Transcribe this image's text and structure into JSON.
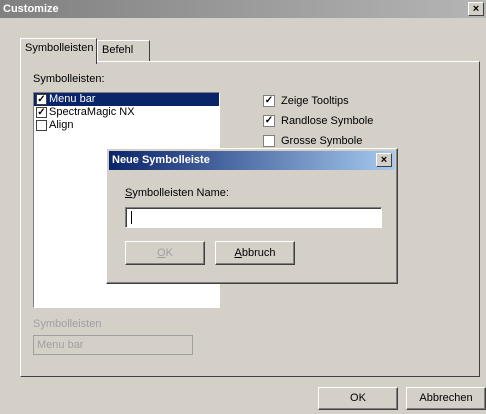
{
  "window": {
    "title": "Customize",
    "close_glyph": "×"
  },
  "tabs": [
    {
      "label": "Symbolleisten",
      "active": true
    },
    {
      "label": "Befehl",
      "active": false
    }
  ],
  "toolbars_panel": {
    "label": "Symbolleisten:",
    "items": [
      {
        "label": "Menu bar",
        "checked": true,
        "selected": true
      },
      {
        "label": "SpectraMagic NX",
        "checked": true,
        "selected": false
      },
      {
        "label": "Align",
        "checked": false,
        "selected": false
      }
    ],
    "name_label": "Symbolleisten",
    "name_value": "Menu bar"
  },
  "options": [
    {
      "label": "Zeige Tooltips",
      "checked": true
    },
    {
      "label": "Randlose Symbole",
      "checked": true
    },
    {
      "label": "Grosse Symbole",
      "checked": false
    }
  ],
  "footer": {
    "ok": "OK",
    "cancel": "Abbrechen"
  },
  "new_toolbar_dialog": {
    "title": "Neue Symbolleiste",
    "close_glyph": "×",
    "name_label_first": "S",
    "name_label_rest": "ymbolleisten Name:",
    "name_value": "",
    "ok_first": "O",
    "ok_rest": "K",
    "cancel_first": "A",
    "cancel_rest": "bbruch"
  },
  "check_glyph": "✓"
}
